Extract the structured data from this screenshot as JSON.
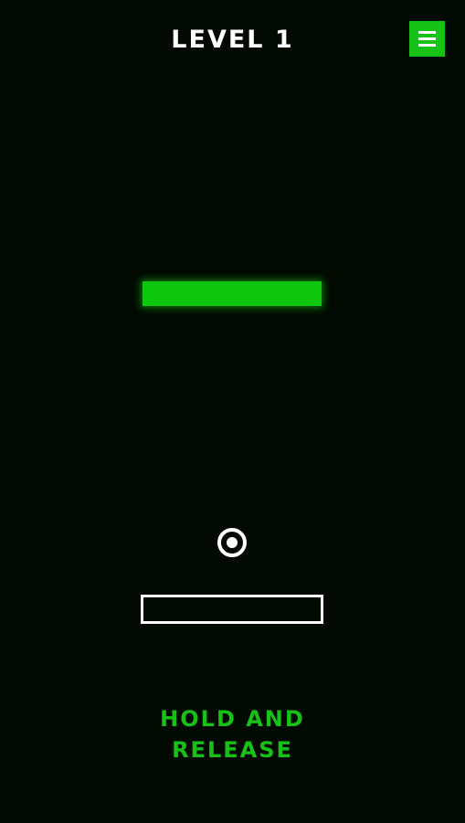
{
  "header": {
    "level_title": "LEVEL 1",
    "menu_icon": "hamburger-menu-icon"
  },
  "game": {
    "target_color": "#0fc70f",
    "ball_icon": "ring-ball",
    "pad_color": "#ffffff"
  },
  "instructions": {
    "line1": "HOLD AND",
    "line2": "RELEASE"
  },
  "colors": {
    "background": "#020a02",
    "accent": "#16c216",
    "foreground": "#ffffff"
  }
}
